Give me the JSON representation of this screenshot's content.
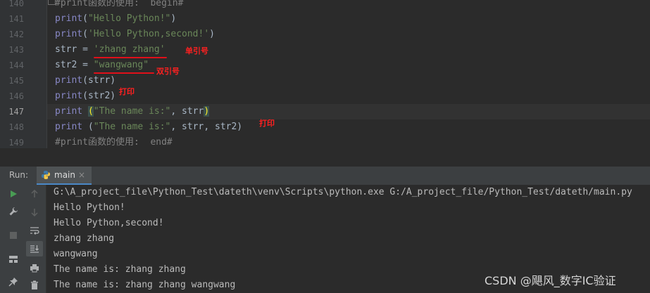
{
  "editor": {
    "line_numbers": [
      "140",
      "141",
      "142",
      "143",
      "144",
      "145",
      "146",
      "147",
      "148",
      "149"
    ],
    "lines": {
      "l140": "#print函数的使用:  begin#",
      "l141_fn": "print",
      "l141_open": "(",
      "l141_str": "\"Hello Python!\"",
      "l141_close": ")",
      "l142_fn": "print",
      "l142_open": "(",
      "l142_str": "'Hello Python,second!'",
      "l142_close": ")",
      "l143_var": "strr",
      "l143_eq": " = ",
      "l143_str": "'zhang zhang'",
      "l144_var": "str2",
      "l144_eq": " = ",
      "l144_str": "\"wangwang\"",
      "l145_fn": "print",
      "l145_rest": "(strr)",
      "l146_fn": "print",
      "l146_rest": "(str2)",
      "l147_fn": "print",
      "l147_space": " ",
      "l147_open": "(",
      "l147_str": "\"The name is:\"",
      "l147_mid": ", strr",
      "l147_close": ")",
      "l148_fn": "print",
      "l148_space": " ",
      "l148_open": "(",
      "l148_str": "\"The name is:\"",
      "l148_mid": ", strr, str2)",
      "l149": "#print函数的使用:  end#"
    },
    "annotations": {
      "single_quote": "单引号",
      "double_quote": "双引号",
      "print1": "打印",
      "print2": "打印"
    }
  },
  "run": {
    "label": "Run:",
    "tab_label": "main",
    "tab_close": "×",
    "output": [
      "G:\\A_project_file\\Python_Test\\dateth\\venv\\Scripts\\python.exe G:/A_project_file/Python_Test/dateth/main.py",
      "Hello Python!",
      "Hello Python,second!",
      "zhang zhang",
      "wangwang",
      "The name is: zhang zhang",
      "The name is: zhang zhang wangwang"
    ]
  },
  "watermark": "CSDN @飓风_数字IC验证",
  "colors": {
    "background": "#2b2b2b",
    "string": "#6a8759",
    "builtin": "#8888c6",
    "comment": "#808080",
    "annotation_red": "#ff2020",
    "run_green": "#499c54"
  },
  "icons": [
    "run-icon",
    "wrench-icon",
    "stop-icon",
    "layout-icon",
    "pin-icon",
    "up-arrow-icon",
    "down-arrow-icon",
    "soft-wrap-icon",
    "scroll-to-end-icon",
    "print-icon",
    "trash-icon",
    "python-icon",
    "close-icon"
  ]
}
